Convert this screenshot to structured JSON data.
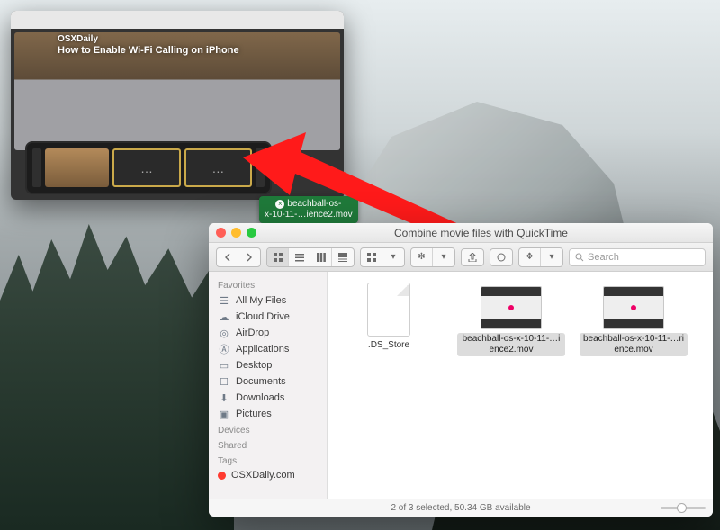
{
  "quicktime": {
    "title": "",
    "webpage_logo": "OSXDaily",
    "webpage_headline": "How to Enable Wi-Fi Calling on iPhone",
    "slot_placeholder": "…"
  },
  "drag_badge": {
    "line1": "beachball-os-",
    "line2": "x-10-11-…ience2.mov"
  },
  "finder": {
    "title": "Combine movie files with QuickTime",
    "toolbar": {
      "search_placeholder": "Search"
    },
    "sidebar": {
      "headers": {
        "favorites": "Favorites",
        "devices": "Devices",
        "shared": "Shared",
        "tags": "Tags"
      },
      "favorites": [
        {
          "label": "All My Files",
          "icon": "all-my-files"
        },
        {
          "label": "iCloud Drive",
          "icon": "icloud"
        },
        {
          "label": "AirDrop",
          "icon": "airdrop"
        },
        {
          "label": "Applications",
          "icon": "applications"
        },
        {
          "label": "Desktop",
          "icon": "desktop"
        },
        {
          "label": "Documents",
          "icon": "documents"
        },
        {
          "label": "Downloads",
          "icon": "downloads"
        },
        {
          "label": "Pictures",
          "icon": "pictures"
        }
      ],
      "tags": [
        {
          "label": "OSXDaily.com",
          "color": "#ff3b30"
        }
      ]
    },
    "files": [
      {
        "name": ".DS_Store",
        "kind": "doc",
        "selected": false
      },
      {
        "name": "beachball-os-x-10-11-…ience2.mov",
        "kind": "mov",
        "selected": true
      },
      {
        "name": "beachball-os-x-10-11-…rience.mov",
        "kind": "mov",
        "selected": true
      }
    ],
    "status": "2 of 3 selected, 50.34 GB available"
  }
}
